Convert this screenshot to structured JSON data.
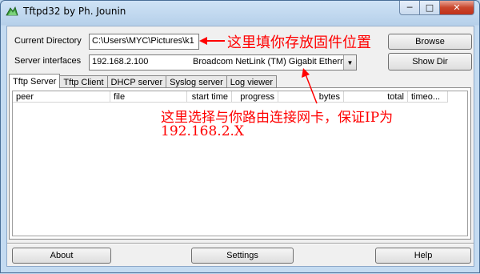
{
  "window": {
    "title": "Tftpd32 by Ph. Jounin",
    "minimize": "─",
    "maximize": "□",
    "close": "✕"
  },
  "current_directory": {
    "label": "Current Directory",
    "value": "C:\\Users\\MYC\\Pictures\\k1",
    "browse_label": "Browse"
  },
  "server_interfaces": {
    "label": "Server interfaces",
    "ip": "192.168.2.100",
    "adapter": "Broadcom NetLink (TM) Gigabit Etherne",
    "show_dir_label": "Show Dir"
  },
  "tabs": [
    "Tftp Server",
    "Tftp Client",
    "DHCP server",
    "Syslog server",
    "Log viewer"
  ],
  "columns": [
    "peer",
    "file",
    "start time",
    "progress",
    "bytes",
    "total",
    "timeo..."
  ],
  "buttons": {
    "about": "About",
    "settings": "Settings",
    "help": "Help"
  },
  "annotations": {
    "first": "这里填你存放固件位置",
    "second_line1": "这里选择与你路由连接网卡，保证IP为",
    "second_line2": "192.168.2.X"
  },
  "colors": {
    "annotation": "#ff0000"
  }
}
